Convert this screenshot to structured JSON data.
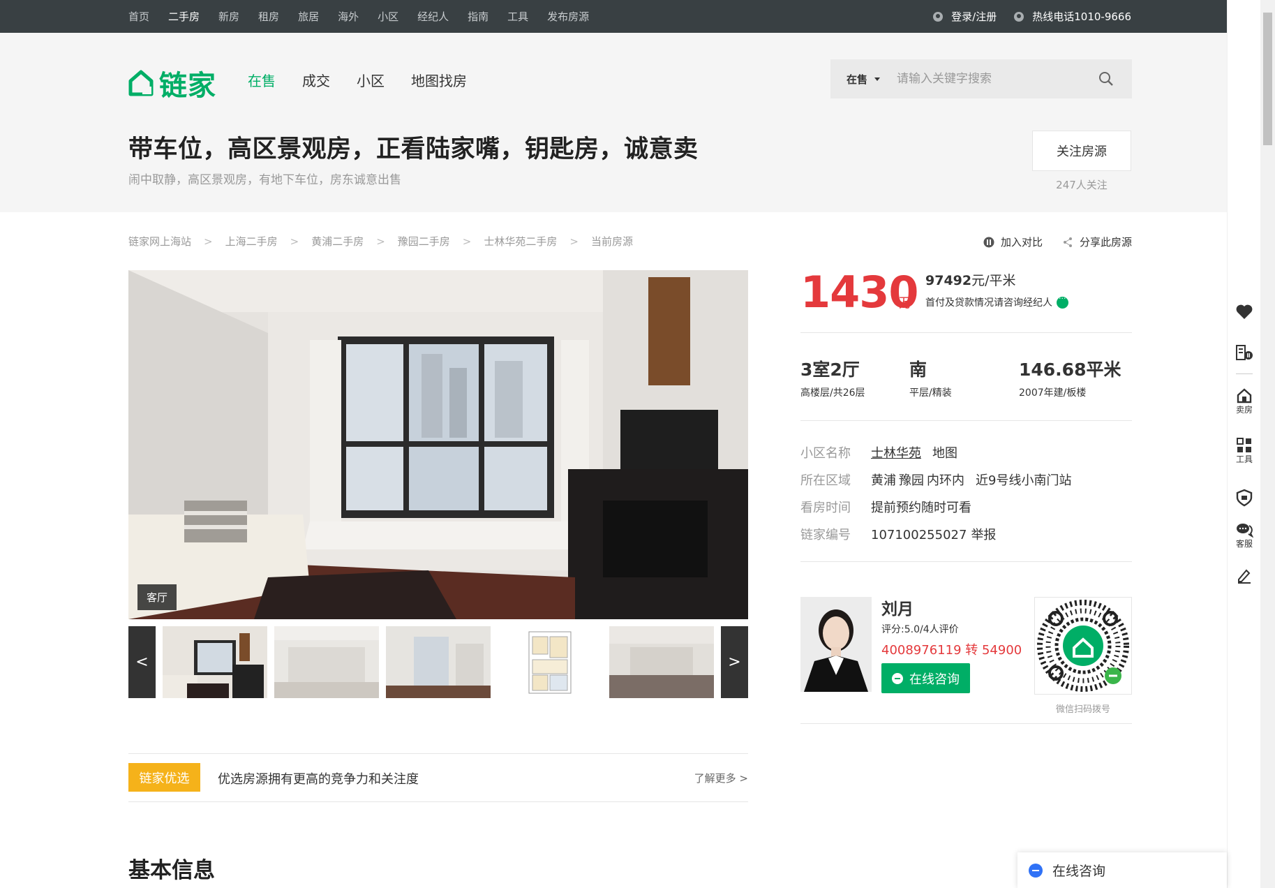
{
  "topnav": {
    "items": [
      "首页",
      "二手房",
      "新房",
      "租房",
      "旅居",
      "海外",
      "小区",
      "经纪人",
      "指南",
      "工具",
      "发布房源"
    ],
    "login": "登录/注册",
    "hotline": "热线电话1010-9666"
  },
  "header": {
    "logo_text": "链家",
    "nav": [
      "在售",
      "成交",
      "小区",
      "地图找房"
    ],
    "search": {
      "type": "在售",
      "placeholder": "请输入关键字搜索"
    }
  },
  "listing": {
    "title": "带车位，高区景观房，正看陆家嘴，钥匙房，诚意卖",
    "subtitle": "闹中取静，高区景观房，有地下车位，房东诚意出售",
    "follow_label": "关注房源",
    "follow_count": "247人关注"
  },
  "breadcrumb": [
    "链家网上海站",
    "上海二手房",
    "黄浦二手房",
    "豫园二手房",
    "士林华苑二手房",
    "当前房源"
  ],
  "actions": {
    "compare": "加入对比",
    "share": "分享此房源"
  },
  "gallery": {
    "current_tag": "客厅",
    "prev": "<",
    "next": ">"
  },
  "price": {
    "total": "1430",
    "unit": "万",
    "unit_price_num": "97492",
    "unit_price_suffix": "元/平米",
    "tip": "首付及贷款情况请咨询经纪人"
  },
  "room": {
    "layout": "3室2厅",
    "floor": "高楼层/共26层",
    "orientation": "南",
    "decor": "平层/精装",
    "area": "146.68平米",
    "year": "2007年建/板楼"
  },
  "info": {
    "community_label": "小区名称",
    "community": "士林华苑",
    "map": "地图",
    "area_label": "所在区域",
    "district": "黄浦",
    "block": "豫园",
    "ring": "内环内",
    "subway": "近9号线小南门站",
    "visit_label": "看房时间",
    "visit": "提前预约随时可看",
    "id_label": "链家编号",
    "id": "107100255027",
    "report": "举报"
  },
  "agent": {
    "name": "刘月",
    "score": "评分:5.0/4人评价",
    "phone": "4008976119 转 54900",
    "consult": "在线咨询",
    "qr_caption": "微信扫码拨号"
  },
  "preferred": {
    "tag": "链家优选",
    "text": "优选房源拥有更高的竞争力和关注度",
    "more": "了解更多 >"
  },
  "section": {
    "basic_info": "基本信息"
  },
  "right_toolbar": {
    "sell": "卖房",
    "tools": "工具",
    "service": "客服"
  },
  "floating": {
    "consult": "在线咨询"
  },
  "colors": {
    "brand": "#00ae66",
    "price": "#e4393c",
    "tag": "#f5b21a",
    "topbar": "#394043"
  }
}
